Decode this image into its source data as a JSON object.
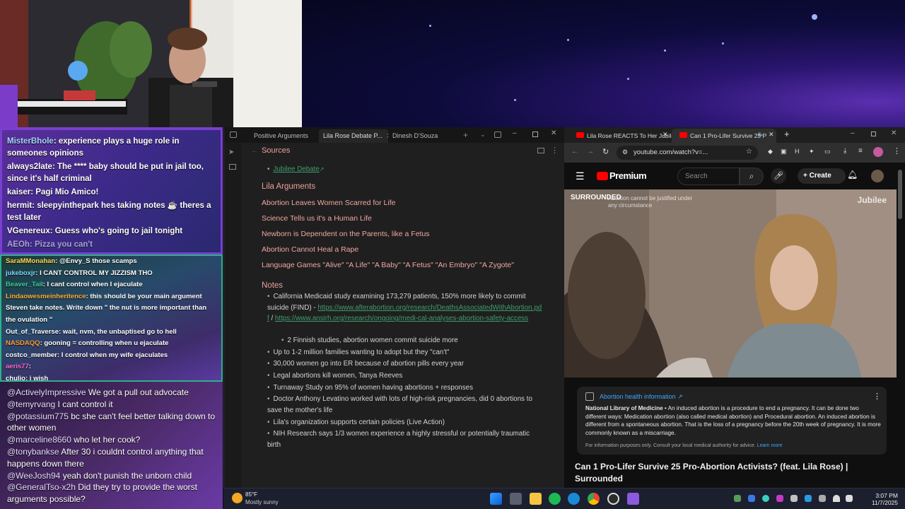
{
  "chat_top": [
    {
      "user": "MisterBhole",
      "text": "experience plays a huge role in someones opinions"
    },
    {
      "user": "always2late",
      "text": "The **** baby should be put in jail too, since it's half criminal"
    },
    {
      "user": "kaiser",
      "text": "Pagi Mio Amico!"
    },
    {
      "user": "hermit",
      "text": "sleepyinthepark hes taking notes ☕ theres a test later"
    },
    {
      "user": "VGenereux",
      "text": "Guess who's going to jail tonight"
    },
    {
      "user": "AEOh",
      "text": "Pizza you can't"
    }
  ],
  "chat_mid": [
    {
      "user": "SaraMMonahan",
      "text": "@Envy_S those scamps",
      "color": "#ffd84a"
    },
    {
      "user": "jukeboxjr",
      "text": "I CANT CONTROL MY JIZZISM THO",
      "color": "#7ad7ff"
    },
    {
      "user": "Beaver_Tail",
      "text": "I cant control when I ejaculate",
      "color": "#3ad0a0"
    },
    {
      "user": "Lindaowesmeinheritence",
      "text": "this should be your main argument Steven take notes. Write down \" the nut is more important than the ovulation \"",
      "color": "#ffb03a"
    },
    {
      "user": "Out_of_Traverse",
      "text": "wait, nvm, the unbaptised go to hell",
      "color": "#ffffff"
    },
    {
      "user": "NASDAQQ",
      "text": "gooning = controlling when u ejaculate",
      "color": "#ff9a3a"
    },
    {
      "user": "costco_member",
      "text": "I control when my wife ejaculates",
      "color": "#ffffff"
    },
    {
      "user": "aeris77",
      "text": "",
      "color": "#ff6ad5"
    },
    {
      "user": "chulio",
      "text": "i wish",
      "color": "#ffffff"
    }
  ],
  "chat_bottom": [
    {
      "user": "@ActivelyImpressive",
      "text": "We got a pull out advocate"
    },
    {
      "user": "@temyrvang",
      "text": "I cant control it"
    },
    {
      "user": "@potassium775",
      "text": "bc she can't feel better talking down to other women"
    },
    {
      "user": "@marceline8660",
      "text": "who let her cook?"
    },
    {
      "user": "@tonybankse",
      "text": "After 30 i couldnt control anything that happens down there"
    },
    {
      "user": "@WeeJosh94",
      "text": "yeah don't punish the unborn child"
    },
    {
      "user": "@GeneralTso-x2h",
      "text": "Did they try to provide the worst arguments possible?"
    }
  ],
  "notes": {
    "tabs": [
      "Positive Arguments",
      "Lila Rose Debate P...",
      "Dinesh D'Souza"
    ],
    "sources_heading": "Sources",
    "source_link": "Jubilee Debate",
    "lila_heading": "Lila Arguments",
    "arguments": [
      "Abortion Leaves Women Scarred for Life",
      "Science Tells us it's a Human Life",
      "Newborn is Dependent on the Parents, like a Fetus",
      "Abortion Cannot Heal a Rape",
      "Language Games \"Alive\" \"A Life\" \"A Baby\" \"A Fetus\" \"An Embryo\" \"A Zygote\""
    ],
    "notes_heading": "Notes",
    "note1_text": "California Medicaid study examining 173,279 patients, 150% more likely to commit suicide (FIND) - ",
    "note1_link1": "https://www.afterabortion.org/research/DeathsAssociatedWithAbortion.pdf",
    "note1_sep": " / ",
    "note1_link2": "https://www.ansirh.org/research/ongoing/medi-cal-analyses-abortion-safety-access",
    "subnote": "2 Finnish studies, abortion women commit suicide more",
    "items": [
      "Up to 1-2 million families wanting to adopt but they \"can't\"",
      "30,000 women go into ER because of abortion pills every year",
      "Legal abortions kill women, Tanya Reeves",
      "Turnaway Study on 95% of women having abortions + responses",
      "Doctor Anthony Levatino worked with lots of high-risk pregnancies, did 0 abortions to save the mother's life",
      "Lila's organization supports certain policies (Live Action)",
      "NIH Research says 1/3 women experience a highly stressful or potentially traumatic birth"
    ]
  },
  "browser": {
    "tabs": [
      "Lila Rose REACTS To Her Jubilee",
      "Can 1 Pro-Lifer Survive 25 P"
    ],
    "url": "youtube.com/watch?v=...",
    "brand": "Premium",
    "search_placeholder": "Search",
    "create_label": "Create",
    "video_overlay_brand": "SURROUNDED",
    "video_overlay_text": "Abortion cannot be justified under any circumstance",
    "jubilee": "Jubilee",
    "info_title": "Abortion health information ↗",
    "info_source": "National Library of Medicine",
    "info_body": " • An induced abortion is a procedure to end a pregnancy. It can be done two different ways: Medication abortion (also called medical abortion) and Procedural abortion. An induced abortion is different from a spontaneous abortion. That is the loss of a pregnancy before the 20th week of pregnancy. It is more commonly known as a miscarriage.",
    "info_footer": "For information purposes only. Consult your local medical authority for advice.",
    "info_learn": "Learn more",
    "video_title": "Can 1 Pro-Lifer Survive 25 Pro-Abortion Activists? (feat. Lila Rose) | Surrounded"
  },
  "taskbar": {
    "weather_temp": "85°F",
    "weather_desc": "Mostly sunny",
    "time": "3:07 PM",
    "date": "11/7/2025"
  }
}
